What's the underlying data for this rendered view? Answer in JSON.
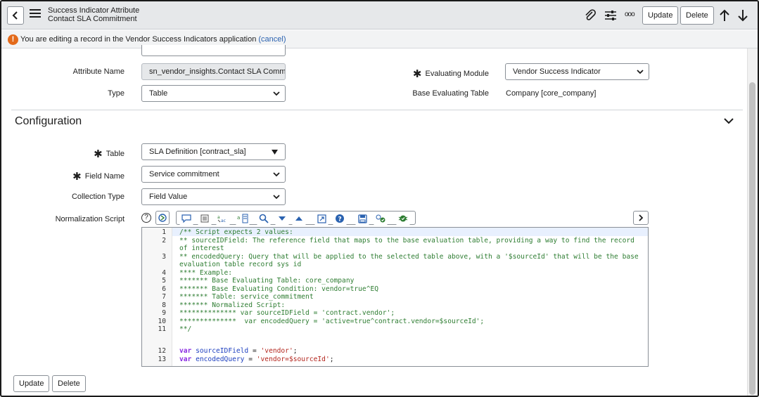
{
  "header": {
    "title_line1": "Success Indicator Attribute",
    "title_line2": "Contact SLA Commitment",
    "update_label": "Update",
    "delete_label": "Delete",
    "more_label": "ooo"
  },
  "banner": {
    "text": "You are editing a record in the Vendor Success Indicators application",
    "cancel_label": "(cancel)"
  },
  "form": {
    "attribute_name_label": "Attribute Name",
    "attribute_name_value": "sn_vendor_insights.Contact SLA Commitme",
    "type_label": "Type",
    "type_value": "Table",
    "evaluating_module_label": "Evaluating Module",
    "evaluating_module_value": "Vendor Success Indicator",
    "base_table_label": "Base Evaluating Table",
    "base_table_value": "Company [core_company]"
  },
  "configuration": {
    "title": "Configuration",
    "table_label": "Table",
    "table_value": "SLA Definition [contract_sla]",
    "field_name_label": "Field Name",
    "field_name_value": "Service commitment",
    "collection_type_label": "Collection Type",
    "collection_type_value": "Field Value",
    "script_label": "Normalization Script",
    "help_glyph": "?"
  },
  "script_lines": [
    {
      "n": "1",
      "t": "/** Script expects 2 values:"
    },
    {
      "n": "2",
      "t": "** sourceIDField: The reference field that maps to the base evaluation table, providing a way to find the record"
    },
    {
      "n": "",
      "t": "of interest"
    },
    {
      "n": "3",
      "t": "** encodedQuery: Query that will be applied to the selected table above, with a '$sourceId' that will be the base"
    },
    {
      "n": "",
      "t": "evaluation table record sys id"
    },
    {
      "n": "4",
      "t": "**** Example:"
    },
    {
      "n": "5",
      "t": "******* Base Evaluating Table: core_company"
    },
    {
      "n": "6",
      "t": "******* Base Evaluating Condition: vendor=true^EQ"
    },
    {
      "n": "7",
      "t": "******* Table: service_commitment"
    },
    {
      "n": "8",
      "t": "******* Normalized Script:"
    },
    {
      "n": "9",
      "t": "************** var sourceIDField = 'contract.vendor';"
    },
    {
      "n": "10",
      "t": "**************  var encodedQuery = 'active=true^contract.vendor=$sourceId';"
    },
    {
      "n": "11",
      "t": "**/"
    }
  ],
  "code_line_12": {
    "n": "12",
    "kw": "var",
    "id": "sourceIDField",
    "op": " = ",
    "str": "'vendor'",
    "end": ";"
  },
  "code_line_13": {
    "n": "13",
    "kw": "var",
    "id": "encodedQuery",
    "op": " = ",
    "str": "'vendor=$sourceId'",
    "end": ";"
  },
  "footer": {
    "update_label": "Update",
    "delete_label": "Delete"
  }
}
